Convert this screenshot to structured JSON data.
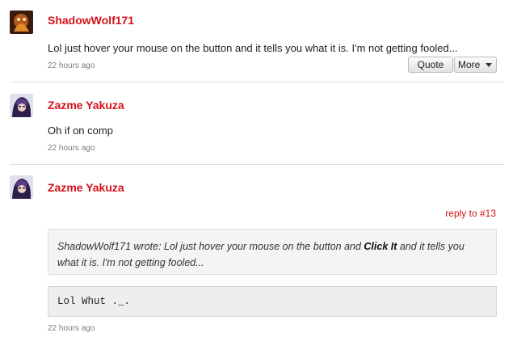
{
  "comments": [
    {
      "author": "ShadowWolf171",
      "text": "Lol just hover your mouse on the button and it tells you what it is. I'm not getting fooled...",
      "time": "22 hours ago",
      "actions": {
        "quote": "Quote",
        "more": "More"
      }
    },
    {
      "author": "Zazme Yakuza",
      "text": "Oh if on comp",
      "time": "22 hours ago"
    },
    {
      "author": "Zazme Yakuza",
      "reply_to": "reply to #13",
      "quote": {
        "prefix": "ShadowWolf171 wrote: Lol just hover your mouse on the button and ",
        "bold": "Click It",
        "suffix": " and it tells you what it is. I'm not getting fooled..."
      },
      "code": "Lol Whut ._.",
      "time": "22 hours ago"
    }
  ],
  "colors": {
    "author": "#d3121b",
    "link": "#d3121b",
    "timestamp": "#7d7d7d"
  },
  "icons": {
    "more_dropdown": "caret-down-icon"
  }
}
